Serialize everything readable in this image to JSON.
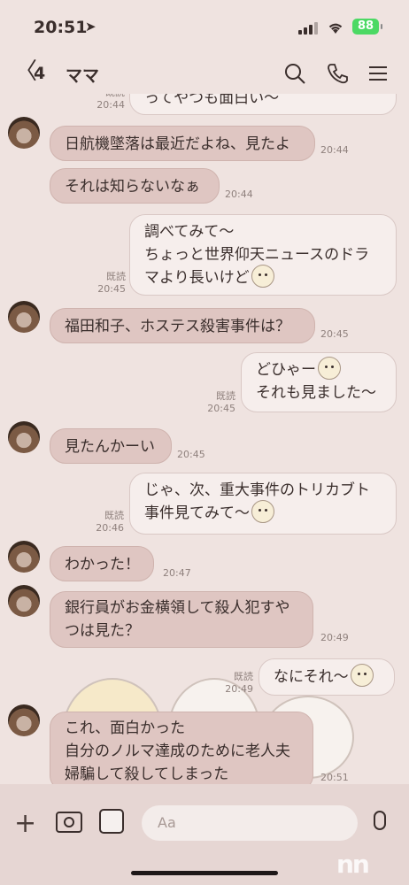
{
  "status": {
    "time": "20:51",
    "battery": "88"
  },
  "header": {
    "unread_count": "4",
    "title": "ママ",
    "icons": [
      "search-icon",
      "phone-icon",
      "menu-icon"
    ]
  },
  "messages": {
    "m0": {
      "text": "ってやつも面白い〜",
      "read": "既読",
      "time": "20:44"
    },
    "m1": {
      "text": "日航機墜落は最近だよね、見たよ",
      "time": "20:44"
    },
    "m2": {
      "text": "それは知らないなぁ",
      "time": "20:44"
    },
    "m3": {
      "line1": "調べてみて〜",
      "line2": "ちょっと世界仰天ニュースのドラ",
      "line3": "マより長いけど",
      "read": "既読",
      "time": "20:45"
    },
    "m4": {
      "text": "福田和子、ホステス殺害事件は？",
      "time": "20:45"
    },
    "m5": {
      "line1": "どひゃー",
      "line2": "それも見ました〜",
      "read": "既読",
      "time": "20:45"
    },
    "m6": {
      "text": "見たんかーい",
      "time": "20:45"
    },
    "m7": {
      "line1": "じゃ、次、重大事件のトリカブト",
      "line2": "事件見てみて〜",
      "read": "既読",
      "time": "20:46"
    },
    "m8": {
      "text": "わかった！",
      "time": "20:47"
    },
    "m9": {
      "line1": "銀行員がお金横領して殺人犯すや",
      "line2": "つは見た？",
      "time": "20:49"
    },
    "m10": {
      "text": "なにそれ〜",
      "read": "既読",
      "time": "20:49"
    },
    "m11": {
      "line1": "これ、面白かった",
      "line2": "自分のノルマ達成のために老人夫",
      "line3": "婦騙して殺してしまった",
      "time": "20:51"
    }
  },
  "input": {
    "placeholder": "Aa"
  },
  "colors": {
    "incoming_bubble": "#dfc6c2",
    "outgoing_bubble": "#f6eeec",
    "background": "#efe3e0",
    "battery": "#4cd964"
  }
}
